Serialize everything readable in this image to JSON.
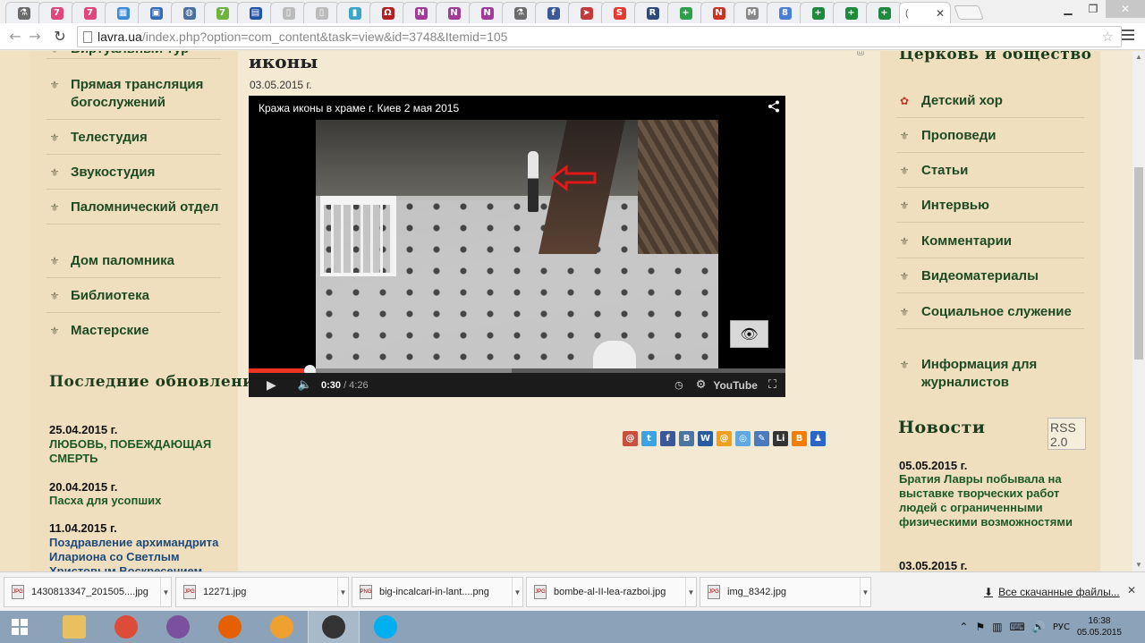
{
  "browser": {
    "tabs": [
      {
        "icon": "flask-icon",
        "color": "#6b6b6b",
        "glyph": "⚗"
      },
      {
        "icon": "f-pink-icon",
        "color": "#e0457b",
        "glyph": "7"
      },
      {
        "icon": "f-pink-icon",
        "color": "#e0457b",
        "glyph": "7"
      },
      {
        "icon": "grid-blue-icon",
        "color": "#3a8ad8",
        "glyph": "▦"
      },
      {
        "icon": "photo-icon",
        "color": "#2f6db8",
        "glyph": "▣"
      },
      {
        "icon": "globe-icon",
        "color": "#4a6fa0",
        "glyph": "◍"
      },
      {
        "icon": "seven-green-icon",
        "color": "#6cb43c",
        "glyph": "7"
      },
      {
        "icon": "flag-icon",
        "color": "#2255aa",
        "glyph": "▤"
      },
      {
        "icon": "page-icon",
        "color": "#bbbbbb",
        "glyph": "▯"
      },
      {
        "icon": "page-icon",
        "color": "#bbbbbb",
        "glyph": "▯"
      },
      {
        "icon": "cyan-doc-icon",
        "color": "#3aa5c9",
        "glyph": "▮"
      },
      {
        "icon": "red-arch-icon",
        "color": "#b02020",
        "glyph": "Ω"
      },
      {
        "icon": "ntv-icon",
        "color": "#a23a9a",
        "glyph": "N"
      },
      {
        "icon": "ntv-icon",
        "color": "#a23a9a",
        "glyph": "N"
      },
      {
        "icon": "ntv-icon",
        "color": "#a23a9a",
        "glyph": "N"
      },
      {
        "icon": "flask-icon",
        "color": "#6b6b6b",
        "glyph": "⚗"
      },
      {
        "icon": "facebook-icon",
        "color": "#3b5998",
        "glyph": "f"
      },
      {
        "icon": "bird-icon",
        "color": "#c43a3a",
        "glyph": "➤"
      },
      {
        "icon": "s-red-icon",
        "color": "#e33b2f",
        "glyph": "S"
      },
      {
        "icon": "r-icon",
        "color": "#2c4a7a",
        "glyph": "R"
      },
      {
        "icon": "plus-green-icon",
        "color": "#2da04a",
        "glyph": "+"
      },
      {
        "icon": "nh-icon",
        "color": "#cc3322",
        "glyph": "N"
      },
      {
        "icon": "m-icon",
        "color": "#888888",
        "glyph": "M"
      },
      {
        "icon": "google-icon",
        "color": "#4a7fd8",
        "glyph": "8"
      },
      {
        "icon": "sheet-plus-icon",
        "color": "#1e8a3c",
        "glyph": "+"
      },
      {
        "icon": "sheet-plus-icon",
        "color": "#1e8a3c",
        "glyph": "+"
      },
      {
        "icon": "sheet-plus-icon",
        "color": "#1e8a3c",
        "glyph": "+"
      }
    ],
    "active_tab_favicon": "(",
    "url_host": "lavra.ua",
    "url_path": "/index.php?option=com_content&task=view&id=3748&Itemid=105"
  },
  "left_menu": [
    {
      "label": "Виртуальный тур"
    },
    {
      "label": "Прямая трансляция богослужений"
    },
    {
      "label": "Телестудия"
    },
    {
      "label": "Звукостудия"
    },
    {
      "label": "Паломнический отдел"
    },
    {
      "label": "Дом паломника"
    },
    {
      "label": "Библиотека"
    },
    {
      "label": "Мастерские"
    }
  ],
  "updates": {
    "title": "Последние обновления",
    "items": [
      {
        "date": "25.04.2015 г.",
        "text": "ЛЮБОВЬ, ПОБЕЖДАЮЩАЯ СМЕРТЬ"
      },
      {
        "date": "20.04.2015 г.",
        "text": "Пасха для усопших"
      },
      {
        "date": "11.04.2015 г.",
        "text": "Поздравление архимандрита Илариона со Светлым Христовым Воскресением"
      }
    ]
  },
  "article": {
    "title": "иконы",
    "date": "03.05.2015 г."
  },
  "video": {
    "title": "Кража иконы в храме г. Киев 2 мая 2015",
    "current_time": "0:30",
    "duration": "/ 4:26",
    "played_fraction": 0.1128,
    "buffered_fraction": 0.49,
    "youtube_label": "YouTube"
  },
  "social_icons": [
    {
      "icon": "mailru-icon",
      "color": "#c8503c",
      "glyph": "@"
    },
    {
      "icon": "twitter-icon",
      "color": "#3aa3e3",
      "glyph": "t"
    },
    {
      "icon": "facebook-icon",
      "color": "#3b5998",
      "glyph": "f"
    },
    {
      "icon": "vkontakte-icon",
      "color": "#4c75a3",
      "glyph": "В"
    },
    {
      "icon": "bookmark-icon",
      "color": "#2b5aa0",
      "glyph": "W"
    },
    {
      "icon": "mail-at-icon",
      "color": "#f0a020",
      "glyph": "@"
    },
    {
      "icon": "ya-icon",
      "color": "#60a8e0",
      "glyph": "◎"
    },
    {
      "icon": "pencil-icon",
      "color": "#4a7bbf",
      "glyph": "✎"
    },
    {
      "icon": "liveinternet-icon",
      "color": "#333333",
      "glyph": "Li"
    },
    {
      "icon": "blogger-icon",
      "color": "#f57d00",
      "glyph": "B"
    },
    {
      "icon": "people-icon",
      "color": "#2a66c8",
      "glyph": "♟"
    }
  ],
  "right_menu": {
    "title": "Церковь и общество",
    "items": [
      {
        "label": "Детский хор"
      },
      {
        "label": "Проповеди"
      },
      {
        "label": "Статьи"
      },
      {
        "label": "Интервью"
      },
      {
        "label": "Комментарии"
      },
      {
        "label": "Видеоматериалы"
      },
      {
        "label": "Социальное служение"
      },
      {
        "label": "Информация для журналистов"
      }
    ]
  },
  "news": {
    "title": "Новости",
    "rss_alt": "RSS 2.0",
    "items": [
      {
        "date": "05.05.2015 г.",
        "text": "Братия Лавры побывала на выставке творческих работ людей с ограниченными физическими возможностями"
      },
      {
        "date": "03.05.2015 г.",
        "text": ""
      }
    ]
  },
  "downloads": {
    "items": [
      {
        "name": "1430813347_201505....jpg",
        "type": "JPG"
      },
      {
        "name": "12271.jpg",
        "type": "JPG"
      },
      {
        "name": "big-incalcari-in-lant....png",
        "type": "PNG"
      },
      {
        "name": "bombe-al-II-lea-razboi.jpg",
        "type": "JPG"
      },
      {
        "name": "img_8342.jpg",
        "type": "JPG"
      }
    ],
    "all_label": "Все скачанные файлы..."
  },
  "taskbar": {
    "apps": [
      {
        "icon": "file-explorer-icon",
        "color": "#e8c060"
      },
      {
        "icon": "chrome-icon",
        "color": "#dd4b39"
      },
      {
        "icon": "viber-icon",
        "color": "#7b519d"
      },
      {
        "icon": "firefox-icon",
        "color": "#e66000"
      },
      {
        "icon": "weather-icon",
        "color": "#f0a030"
      },
      {
        "icon": "camera-icon",
        "color": "#333333"
      },
      {
        "icon": "skype-icon",
        "color": "#00aff0"
      }
    ],
    "lang": "РУС",
    "time": "16:38",
    "date": "05.05.2015"
  }
}
